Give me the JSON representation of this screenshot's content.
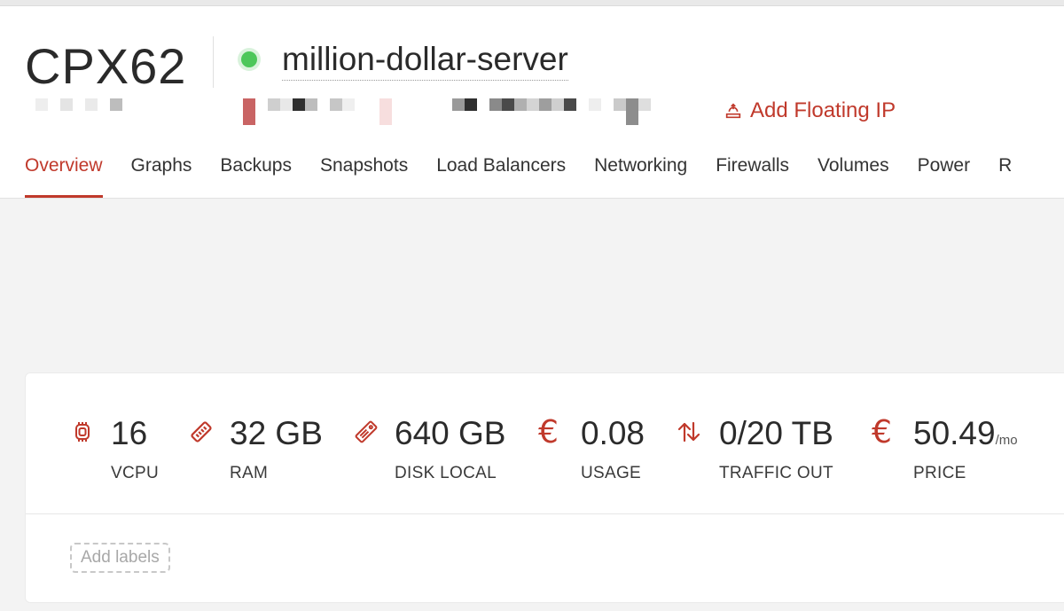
{
  "server": {
    "type": "CPX62",
    "name": "million-dollar-server",
    "status": "running",
    "status_color": "#4cc75a"
  },
  "actions": {
    "add_floating_ip": "Add Floating IP"
  },
  "tabs": [
    {
      "label": "Overview",
      "active": true
    },
    {
      "label": "Graphs"
    },
    {
      "label": "Backups"
    },
    {
      "label": "Snapshots"
    },
    {
      "label": "Load Balancers"
    },
    {
      "label": "Networking"
    },
    {
      "label": "Firewalls"
    },
    {
      "label": "Volumes"
    },
    {
      "label": "Power"
    },
    {
      "label": "R"
    }
  ],
  "specs": {
    "vcpu": {
      "value": "16",
      "label": "VCPU",
      "icon": "cpu-chip-icon"
    },
    "ram": {
      "value": "32 GB",
      "label": "RAM",
      "icon": "ram-stick-icon"
    },
    "disk": {
      "value": "640 GB",
      "label": "DISK LOCAL",
      "icon": "nvme-disk-icon"
    },
    "usage": {
      "value": "0.08",
      "label": "USAGE",
      "icon": "euro-icon"
    },
    "traffic": {
      "value": "0/20 TB",
      "label": "TRAFFIC OUT",
      "icon": "arrows-up-down-icon"
    },
    "price": {
      "value": "50.49",
      "unit": "/mo",
      "label": "PRICE",
      "icon": "euro-icon"
    }
  },
  "labels": {
    "add_labels": "Add labels"
  },
  "colors": {
    "accent": "#c0392b",
    "background": "#f3f3f3"
  }
}
